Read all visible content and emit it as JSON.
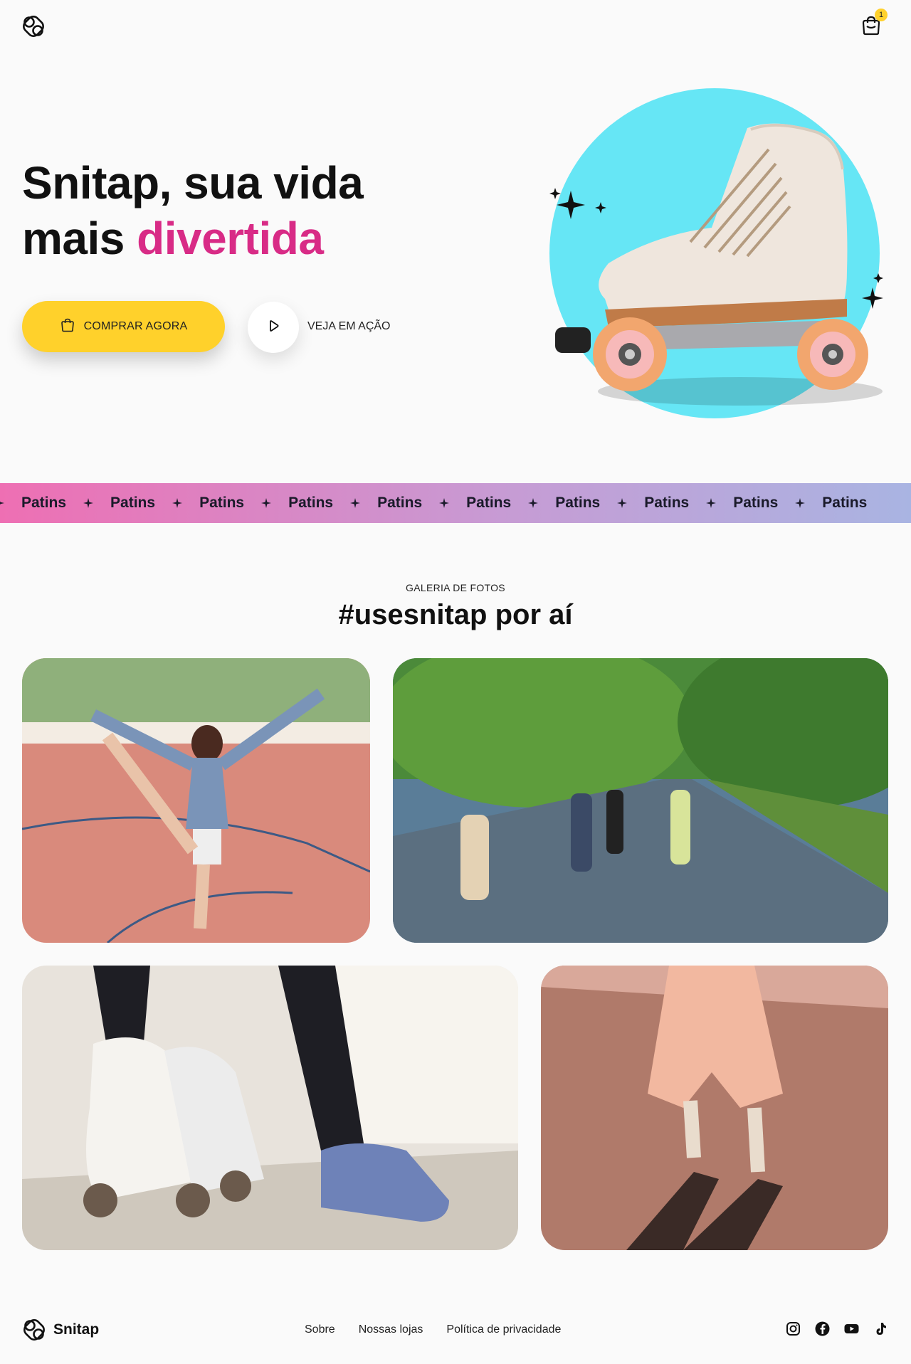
{
  "header": {
    "logo_icon": "snitap-logo-icon",
    "cart_icon": "shopping-bag-icon",
    "cart_count": "1"
  },
  "hero": {
    "title_line1": "Snitap, sua vida",
    "title_line2_plain": "mais ",
    "title_line2_accent": "divertida",
    "buy_button": "COMPRAR AGORA",
    "watch_label": "VEJA EM AÇÃO"
  },
  "marquee": {
    "item": "Patins",
    "items": [
      "Patins",
      "Patins",
      "Patins",
      "Patins",
      "Patins",
      "Patins",
      "Patins",
      "Patins",
      "Patins",
      "Patins"
    ]
  },
  "gallery": {
    "eyebrow": "GALERIA DE FOTOS",
    "title": "#usesnitap por aí"
  },
  "footer": {
    "brand": "Snitap",
    "links": [
      "Sobre",
      "Nossas lojas",
      "Política de privacidade"
    ],
    "socials": [
      "instagram-icon",
      "facebook-icon",
      "youtube-icon",
      "tiktok-icon"
    ]
  },
  "colors": {
    "accent_pink": "#d82b86",
    "button_yellow": "#ffd12b",
    "hero_circle": "#66e6f5",
    "marquee_start": "#ee6fb3",
    "marquee_end": "#a9b4e2"
  }
}
